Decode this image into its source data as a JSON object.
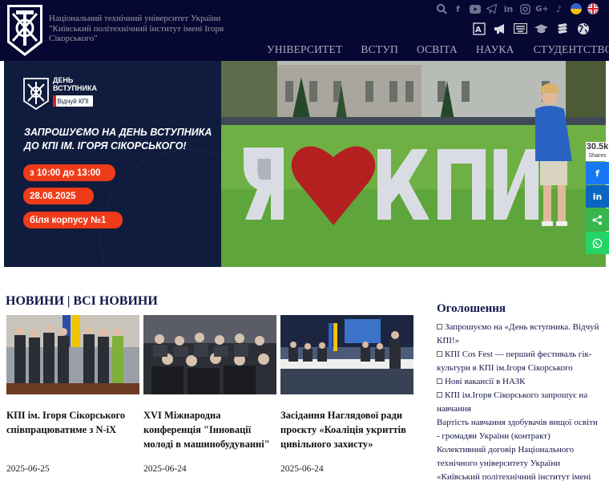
{
  "header": {
    "university_name": "Національний технічний університет України \"Київський політехнічний інститут імені Ігоря Сікорського\"",
    "social_icons": [
      "search-icon",
      "facebook-icon",
      "youtube-icon",
      "telegram-icon",
      "linkedin-icon",
      "instagram-icon",
      "google-plus-icon",
      "tiktok-icon",
      "ukraine-flag-icon",
      "uk-flag-icon"
    ],
    "tool_icons": [
      "dictionary-icon",
      "megaphone-icon",
      "keyboard-icon",
      "graduation-cap-icon",
      "books-icon",
      "globe-icon"
    ],
    "nav": [
      "УНІВЕРСИТЕТ",
      "ВСТУП",
      "ОСВІТА",
      "НАУКА",
      "СТУДЕНТСТВО"
    ]
  },
  "banner": {
    "event_title_line1": "ДЕНЬ",
    "event_title_line2": "ВСТУПНИКА",
    "badge": "Відчуй КПІ",
    "invite": "ЗАПРОШУЄМО НА ДЕНЬ ВСТУПНИКА ДО КПІ ІМ. ІГОРЯ СІКОРСЬКОГО!",
    "time": "з 10:00 до 13:00",
    "date": "28.06.2025",
    "place": "біля корпусу №1",
    "sign_letters": [
      "Я",
      "К",
      "П",
      "І"
    ]
  },
  "share": {
    "count": "30.5k",
    "label": "Shares",
    "buttons": [
      "facebook",
      "linkedin",
      "share",
      "whatsapp"
    ],
    "colors": {
      "facebook": "#1877f2",
      "linkedin": "#0a66c2",
      "share": "#37b64e",
      "whatsapp": "#25d366"
    }
  },
  "news": {
    "title": "НОВИНИ | ВСІ НОВИНИ",
    "items": [
      {
        "headline": "КПІ ім. Ігоря Сікорського співпрацюватиме з N-iX",
        "date": "2025-06-25"
      },
      {
        "headline": "XVI Міжнародна конференція \"Інновації молоді в машинобудуванні\"",
        "date": "2025-06-24"
      },
      {
        "headline": "Засідання Наглядової ради проєкту «Коаліція укриттів цивільного захисту»",
        "date": "2025-06-24"
      }
    ]
  },
  "announcements": {
    "title": "Оголошення",
    "items": [
      {
        "text": "Запрошуємо на «День вступника. Відчуй КПІ!»",
        "bullet": true
      },
      {
        "text": "КПІ Cos Fest — перший фестиваль гік-культури в КПІ ім.Ігоря Сікорського",
        "bullet": true
      },
      {
        "text": "Нові вакансії в НАЗК",
        "bullet": true
      },
      {
        "text": "КПІ ім.Ігоря Сікорського запрошує на навчання",
        "bullet": true
      },
      {
        "text": "Вартість навчання здобувачів вищої освіти - громадян України (контракт)",
        "bullet": false
      },
      {
        "text": "Колективний договір Національного технічного університету України «Київський політехнічний інститут імені",
        "bullet": false
      }
    ]
  },
  "colors": {
    "header_bg": "#070733",
    "accent_orange": "#ef3b1a",
    "heart_red": "#b3201f",
    "link_navy": "#13164a"
  }
}
